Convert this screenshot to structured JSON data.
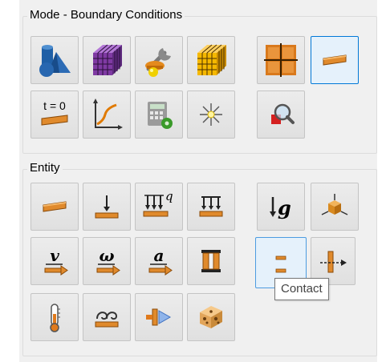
{
  "mode_group": {
    "title": "Mode - Boundary Conditions",
    "buttons": [
      {
        "icon": "geometry-shapes-icon"
      },
      {
        "icon": "mesh-cube-icon"
      },
      {
        "icon": "materials-tool-icon"
      },
      {
        "icon": "gold-mesh-cube-icon"
      },
      {
        "icon": "grid-panel-icon"
      },
      {
        "icon": "boundary-condition-icon",
        "active": true
      },
      {
        "icon": "initial-condition-icon",
        "label": "t = 0"
      },
      {
        "icon": "plot-curve-icon"
      },
      {
        "icon": "calculator-settings-icon"
      },
      {
        "icon": "starburst-icon"
      },
      {
        "icon": "inspect-magnifier-icon"
      }
    ]
  },
  "entity_group": {
    "title": "Entity",
    "buttons": [
      {
        "icon": "surface-bc-icon"
      },
      {
        "icon": "point-load-icon"
      },
      {
        "icon": "heat-flux-load-icon",
        "label": "q"
      },
      {
        "icon": "distributed-load-icon"
      },
      {
        "icon": "gravity-icon",
        "label": "g"
      },
      {
        "icon": "rigid-body-icon"
      },
      {
        "icon": "velocity-icon",
        "label": "v"
      },
      {
        "icon": "angular-velocity-icon",
        "label": "ω"
      },
      {
        "icon": "acceleration-icon",
        "label": "a"
      },
      {
        "icon": "constraint-frame-icon"
      },
      {
        "icon": "contact-icon",
        "hover": true
      },
      {
        "icon": "connector-icon"
      },
      {
        "icon": "temperature-icon"
      },
      {
        "icon": "convection-icon"
      },
      {
        "icon": "flow-arrow-icon"
      },
      {
        "icon": "porous-block-icon"
      }
    ]
  },
  "tooltip": {
    "text": "Contact"
  }
}
